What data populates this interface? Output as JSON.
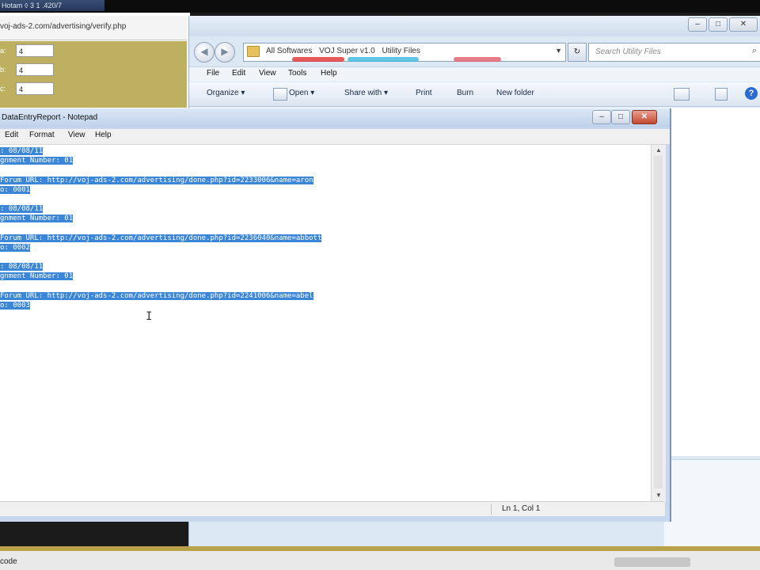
{
  "top_strip": {
    "title": "Hotam ◊ 3 1 .420/7"
  },
  "browser": {
    "url": "voj-ads-2.com/advertising/verify.php",
    "fields": [
      {
        "label": "a:",
        "value": "4"
      },
      {
        "label": "b:",
        "value": "4"
      },
      {
        "label": "c:",
        "value": "4"
      }
    ]
  },
  "explorer": {
    "breadcrumbs": [
      "All Softwares",
      "VOJ Super v1.0",
      "Utility Files"
    ],
    "search_placeholder": "Search Utility Files",
    "menu": [
      "File",
      "Edit",
      "View",
      "Tools",
      "Help"
    ],
    "commands": [
      "Organize ▾",
      "Open ▾",
      "Share with ▾",
      "Print",
      "Burn",
      "New folder"
    ],
    "help_label": "?",
    "title_buttons": [
      "–",
      "□",
      "✕"
    ]
  },
  "notepad": {
    "title": "DataEntryReport - Notepad",
    "menu": [
      "Edit",
      "Format",
      "View",
      "Help"
    ],
    "lines": [
      ": 08/08/11",
      "gnment Number: 01",
      "",
      "Forum URL: http://voj-ads-2.com/advertising/done.php?id=2233006&name=aron",
      "o: 0001",
      "",
      ": 08/08/11",
      "gnment Number: 01",
      "",
      "Forum URL: http://voj-ads-2.com/advertising/done.php?id=2236040&name=abbott",
      "o: 0002",
      "",
      ": 08/08/11",
      "gnment Number: 01",
      "",
      "Forum URL: http://voj-ads-2.com/advertising/done.php?id=2241006&name=abel",
      "o: 0003"
    ],
    "status": "Ln 1, Col 1",
    "title_buttons": [
      "–",
      "□",
      "✕"
    ]
  },
  "bottom": {
    "label": "code"
  },
  "colors": {
    "selection": "#3c86d8",
    "form_bg": "#bdb061",
    "accent": "#2a6bd2"
  }
}
